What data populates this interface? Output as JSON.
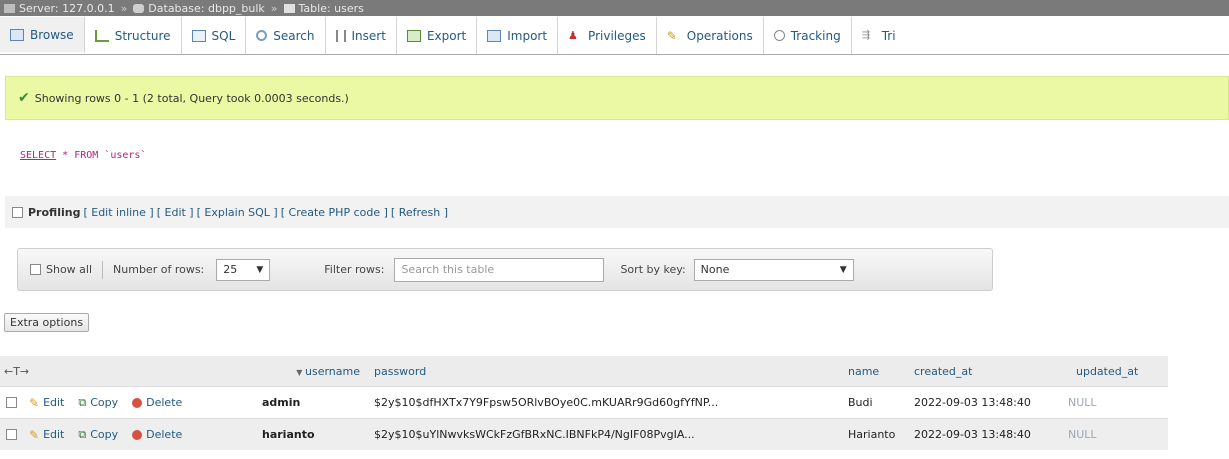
{
  "breadcrumb": {
    "server": "Server: 127.0.0.1",
    "database": "Database: dbpp_bulk",
    "table": "Table: users"
  },
  "tabs": [
    {
      "label": "Browse",
      "icon": "browse-icon"
    },
    {
      "label": "Structure",
      "icon": "structure-icon"
    },
    {
      "label": "SQL",
      "icon": "sql-icon"
    },
    {
      "label": "Search",
      "icon": "search-icon"
    },
    {
      "label": "Insert",
      "icon": "insert-icon"
    },
    {
      "label": "Export",
      "icon": "export-icon"
    },
    {
      "label": "Import",
      "icon": "import-icon"
    },
    {
      "label": "Privileges",
      "icon": "privileges-icon"
    },
    {
      "label": "Operations",
      "icon": "operations-icon"
    },
    {
      "label": "Tracking",
      "icon": "tracking-icon"
    },
    {
      "label": "Tri",
      "icon": "triggers-icon"
    }
  ],
  "message": "Showing rows 0 - 1 (2 total, Query took 0.0003 seconds.)",
  "sql": {
    "select": "SELECT",
    "star": " * ",
    "from": "FROM",
    "table": " `users`"
  },
  "profiling": {
    "label": "Profiling",
    "links": [
      "[ Edit inline ]",
      "[ Edit ]",
      "[ Explain SQL ]",
      "[ Create PHP code ]",
      "[ Refresh ]"
    ]
  },
  "nav": {
    "show_all": "Show all",
    "rows_label": "Number of rows:",
    "rows_value": "25",
    "filter_label": "Filter rows:",
    "filter_placeholder": "Search this table",
    "sort_label": "Sort by key:",
    "sort_value": "None"
  },
  "extra_options": "Extra options",
  "table": {
    "columns": [
      "username",
      "password",
      "name",
      "created_at",
      "updated_at"
    ],
    "actions": {
      "edit": "Edit",
      "copy": "Copy",
      "delete": "Delete"
    },
    "rows": [
      {
        "username": "admin",
        "password": "$2y$10$dfHXTx7Y9Fpsw5ORlvBOye0C.mKUARr9Gd60gfYfNP...",
        "name": "Budi",
        "created_at": "2022-09-03 13:48:40",
        "updated_at": "NULL"
      },
      {
        "username": "harianto",
        "password": "$2y$10$uYlNwvksWCkFzGfBRxNC.IBNFkP4/NgIF08PvgIA...",
        "name": "Harianto",
        "created_at": "2022-09-03 13:48:40",
        "updated_at": "NULL"
      }
    ]
  },
  "colors": {
    "success_bg": "#ebf8a4",
    "link": "#235a81",
    "sql": "#b9217d",
    "breadcrumb_bg": "#7a7a7a"
  }
}
